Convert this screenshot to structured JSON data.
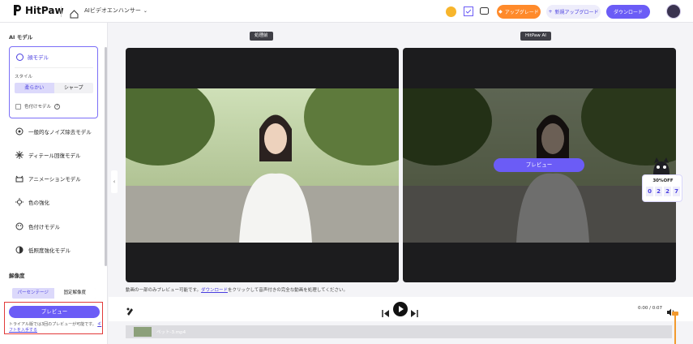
{
  "header": {
    "brand": "HitPaw",
    "product": "AIビデオエンハンサー",
    "upgrade_label": "アップグレード",
    "new_upgrade_label": "新規アップグロード",
    "download_label": "ダウンロード",
    "accent": "#6b5cf6",
    "upgrade_color": "#ff8a2a"
  },
  "sidebar": {
    "ai_model_title": "AI モデル",
    "active_model": {
      "label": "顔モデル",
      "style_label": "スタイル",
      "style_options": [
        "柔らかい",
        "シャープ"
      ],
      "selected_style": "柔らかい",
      "colorize_label": "色付けモデル"
    },
    "models": [
      {
        "label": "一般的なノイズ除去モデル",
        "icon": "noise-icon"
      },
      {
        "label": "ディテール回復モデル",
        "icon": "detail-icon"
      },
      {
        "label": "アニメーションモデル",
        "icon": "animation-icon"
      },
      {
        "label": "色の強化",
        "icon": "color-enhance-icon"
      },
      {
        "label": "色付けモデル",
        "icon": "colorize-icon"
      },
      {
        "label": "低照度強化モデル",
        "icon": "low-light-icon"
      }
    ],
    "resolution_title": "解像度",
    "resolution_tabs": [
      "パーセンテージ",
      "固定解像度"
    ],
    "preview_label": "プレビュー",
    "trial_note": "トライアル版では3回のプレビューが可能です。",
    "trial_link": "ギフトを入手する"
  },
  "main": {
    "before_label": "処理前",
    "after_label": "HitPaw AI",
    "preview_overlay": "プレビュー",
    "note_prefix": "動画の一部のみプレビュー可能です。",
    "note_link": "ダウンロード",
    "note_suffix": "をクリックして音声付きの完全な動画を処理してください。",
    "time": "0:00 / 0:07",
    "clip_name": "ペット-3.mp4"
  },
  "promo": {
    "discount": "30%OFF",
    "countdown": [
      "0",
      "2",
      "2",
      "7"
    ]
  }
}
